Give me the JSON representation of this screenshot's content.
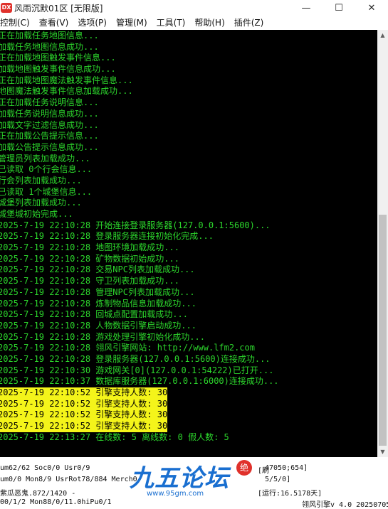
{
  "window": {
    "app_icon_text": "DX",
    "title": "风雨沉默01区 [无限版]",
    "minimize_glyph": "—",
    "maximize_glyph": "☐",
    "close_glyph": "✕"
  },
  "menu": [
    {
      "label": "控制(C)"
    },
    {
      "label": "查看(V)"
    },
    {
      "label": "选项(P)"
    },
    {
      "label": "管理(M)"
    },
    {
      "label": "工具(T)"
    },
    {
      "label": "帮助(H)"
    },
    {
      "label": "插件(Z)"
    }
  ],
  "console_lines": [
    {
      "text": "正在加载任务地图信息...",
      "hl": false
    },
    {
      "text": "加载任务地图信息成功...",
      "hl": false
    },
    {
      "text": "正在加载地图触发事件信息...",
      "hl": false
    },
    {
      "text": "加载地图触发事件信息成功...",
      "hl": false
    },
    {
      "text": "正在加载地图魔法触发事件信息...",
      "hl": false
    },
    {
      "text": "地图魔法触发事件信息加载成功...",
      "hl": false
    },
    {
      "text": "正在加载任务说明信息...",
      "hl": false
    },
    {
      "text": "加载任务说明信息成功...",
      "hl": false
    },
    {
      "text": "加载文字过滤信息成功...",
      "hl": false
    },
    {
      "text": "正在加载公告提示信息...",
      "hl": false
    },
    {
      "text": "加载公告提示信息成功...",
      "hl": false
    },
    {
      "text": "管理员列表加载成功...",
      "hl": false
    },
    {
      "text": "已读取 0个行会信息...",
      "hl": false
    },
    {
      "text": "行会列表加载成功...",
      "hl": false
    },
    {
      "text": "已读取 1个城堡信息...",
      "hl": false
    },
    {
      "text": "城堡列表加载成功...",
      "hl": false
    },
    {
      "text": "城堡城初始完成...",
      "hl": false
    },
    {
      "text": "2025-7-19 22:10:28 开始连接登录服务器(127.0.0.1:5600)...",
      "hl": false
    },
    {
      "text": "2025-7-19 22:10:28 登录服务器连接初始化完成...",
      "hl": false
    },
    {
      "text": "2025-7-19 22:10:28 地图环境加载成功...",
      "hl": false
    },
    {
      "text": "2025-7-19 22:10:28 矿物数据初始成功...",
      "hl": false
    },
    {
      "text": "2025-7-19 22:10:28 交易NPC列表加载成功...",
      "hl": false
    },
    {
      "text": "2025-7-19 22:10:28 守卫列表加载成功...",
      "hl": false
    },
    {
      "text": "2025-7-19 22:10:28 管理NPC列表加载成功...",
      "hl": false
    },
    {
      "text": "2025-7-19 22:10:28 炼制物品信息加载成功...",
      "hl": false
    },
    {
      "text": "2025-7-19 22:10:28 回城点配置加载成功...",
      "hl": false
    },
    {
      "text": "2025-7-19 22:10:28 人物数据引擎启动成功...",
      "hl": false
    },
    {
      "text": "2025-7-19 22:10:28 游戏处理引擎初始化成功...",
      "hl": false
    },
    {
      "text": "2025-7-19 22:10:28 翎风引擎网站: http://www.lfm2.com",
      "hl": false
    },
    {
      "text": "2025-7-19 22:10:28 登录服务器(127.0.0.1:5600)连接成功...",
      "hl": false
    },
    {
      "text": "2025-7-19 22:10:30 游戏网关[0](127.0.0.1:54222)已打开...",
      "hl": false
    },
    {
      "text": "2025-7-19 22:10:37 数据库服务器(127.0.0.1:6000)连接成功...",
      "hl": false
    },
    {
      "text": "2025-7-19 22:10:52 引擎支持人数: 30",
      "hl": true
    },
    {
      "text": "2025-7-19 22:10:52 引擎支持人数: 30",
      "hl": true
    },
    {
      "text": "2025-7-19 22:10:52 引擎支持人数: 30",
      "hl": true
    },
    {
      "text": "2025-7-19 22:10:52 引擎支持人数: 30",
      "hl": true
    },
    {
      "text": "2025-7-19 22:13:27 在线数: 5 离线数: 0 假人数: 5",
      "hl": false
    }
  ],
  "status": {
    "row1_left": "um62/62 Soc0/0 Usr0/9",
    "row1_right": "[刷",
    "row1_right2": "47050;654]",
    "row2_left": "um0/0 Mon8/9 UsrRot78/884 Merch0",
    "row2_right": "5/5/0]",
    "row3_left": "紫瓜恶鬼.872/1420 -",
    "row3_right": "[运行:16.5178天]",
    "row4_left": "00/1/2 Mon88/0/11.0hiPu0/1",
    "row4_right": "翎风引擎v 4.0 20250705"
  },
  "logo": {
    "main": "九五论坛",
    "badge": "绝",
    "url": "www.95gm.com"
  }
}
